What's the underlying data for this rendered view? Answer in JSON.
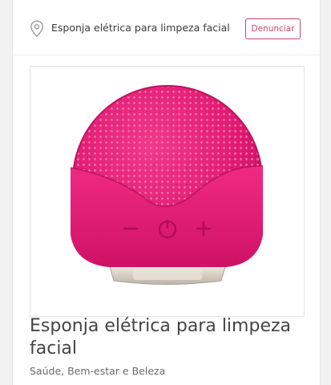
{
  "header": {
    "location_icon": "map-pin-icon",
    "title": "Esponja elétrica para limpeza facial",
    "report_label": "Denunciar"
  },
  "listing": {
    "image_subject": "pink silicone facial cleansing brush",
    "title": "Esponja elétrica para limpeza facial",
    "category": "Saúde, Bem-estar e Beleza"
  },
  "colors": {
    "accent": "#c8466a",
    "product_pink": "#e2156f"
  }
}
